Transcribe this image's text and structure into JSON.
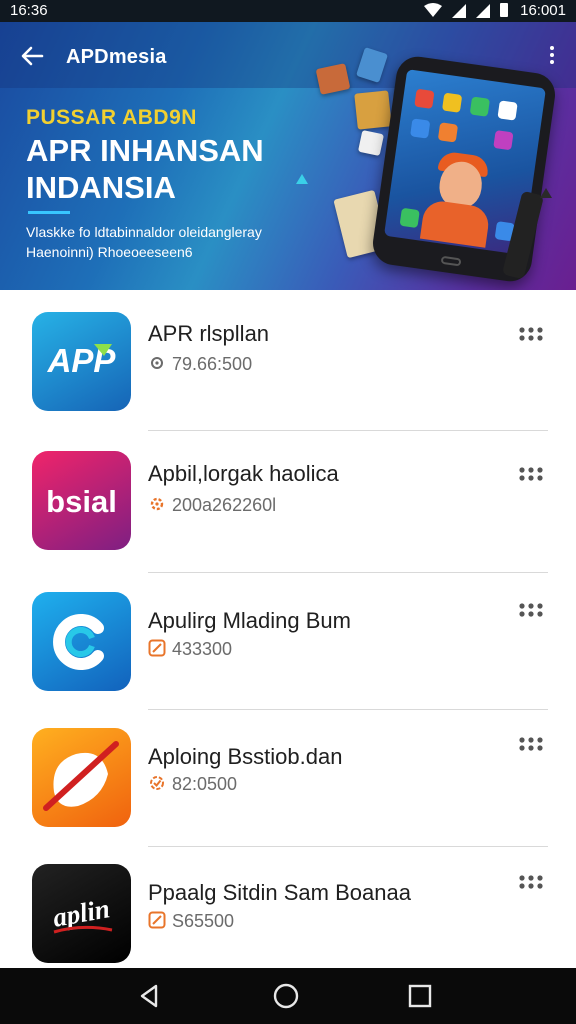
{
  "status_bar": {
    "time_left": "16:36",
    "time_right": "16:001"
  },
  "app_bar": {
    "title": "APDmesia",
    "back_icon": "arrow-left-icon",
    "menu_icon": "more-vert-icon"
  },
  "banner": {
    "kicker": "PUSSAR ABD9N",
    "title": "APR INHANSAN INDANSIA",
    "subtitle": "Vlaskke fo ldtabinnaldor oleidangleray Haenoinni) Rhoeoeeseen6",
    "colors": {
      "kicker": "#f2d030",
      "accent": "#38c6ff"
    }
  },
  "apps": [
    {
      "title": "APR rlspllan",
      "meta": "79.66:500",
      "icon_text": "APP",
      "meta_icon": "gear-icon",
      "icon_colors": [
        "#1fa2d8",
        "#1a68b8"
      ]
    },
    {
      "title": "Apbil,lorgak haolica",
      "meta": "200a262260l",
      "icon_text": "bsial",
      "meta_icon": "gear-icon",
      "icon_colors": [
        "#e81f6a",
        "#8a1f80"
      ]
    },
    {
      "title": "Apulirg Mlading Bum",
      "meta": "433300",
      "icon_text": "C",
      "meta_icon": "edit-icon",
      "icon_colors": [
        "#1aa0e8",
        "#1466c0"
      ]
    },
    {
      "title": "Aploing Bsstiob.dan",
      "meta": "82:0500",
      "icon_text": "",
      "meta_icon": "badge-icon",
      "icon_colors": [
        "#ffa21a",
        "#f06a10"
      ]
    },
    {
      "title": "Ppaalg Sitdin Sam Boanaa",
      "meta": "S65500",
      "icon_text": "aplin",
      "meta_icon": "edit-icon",
      "icon_colors": [
        "#1a1a1a",
        "#000000"
      ]
    }
  ],
  "nav": {
    "back": "triangle-back-icon",
    "home": "circle-home-icon",
    "recents": "square-recents-icon"
  }
}
